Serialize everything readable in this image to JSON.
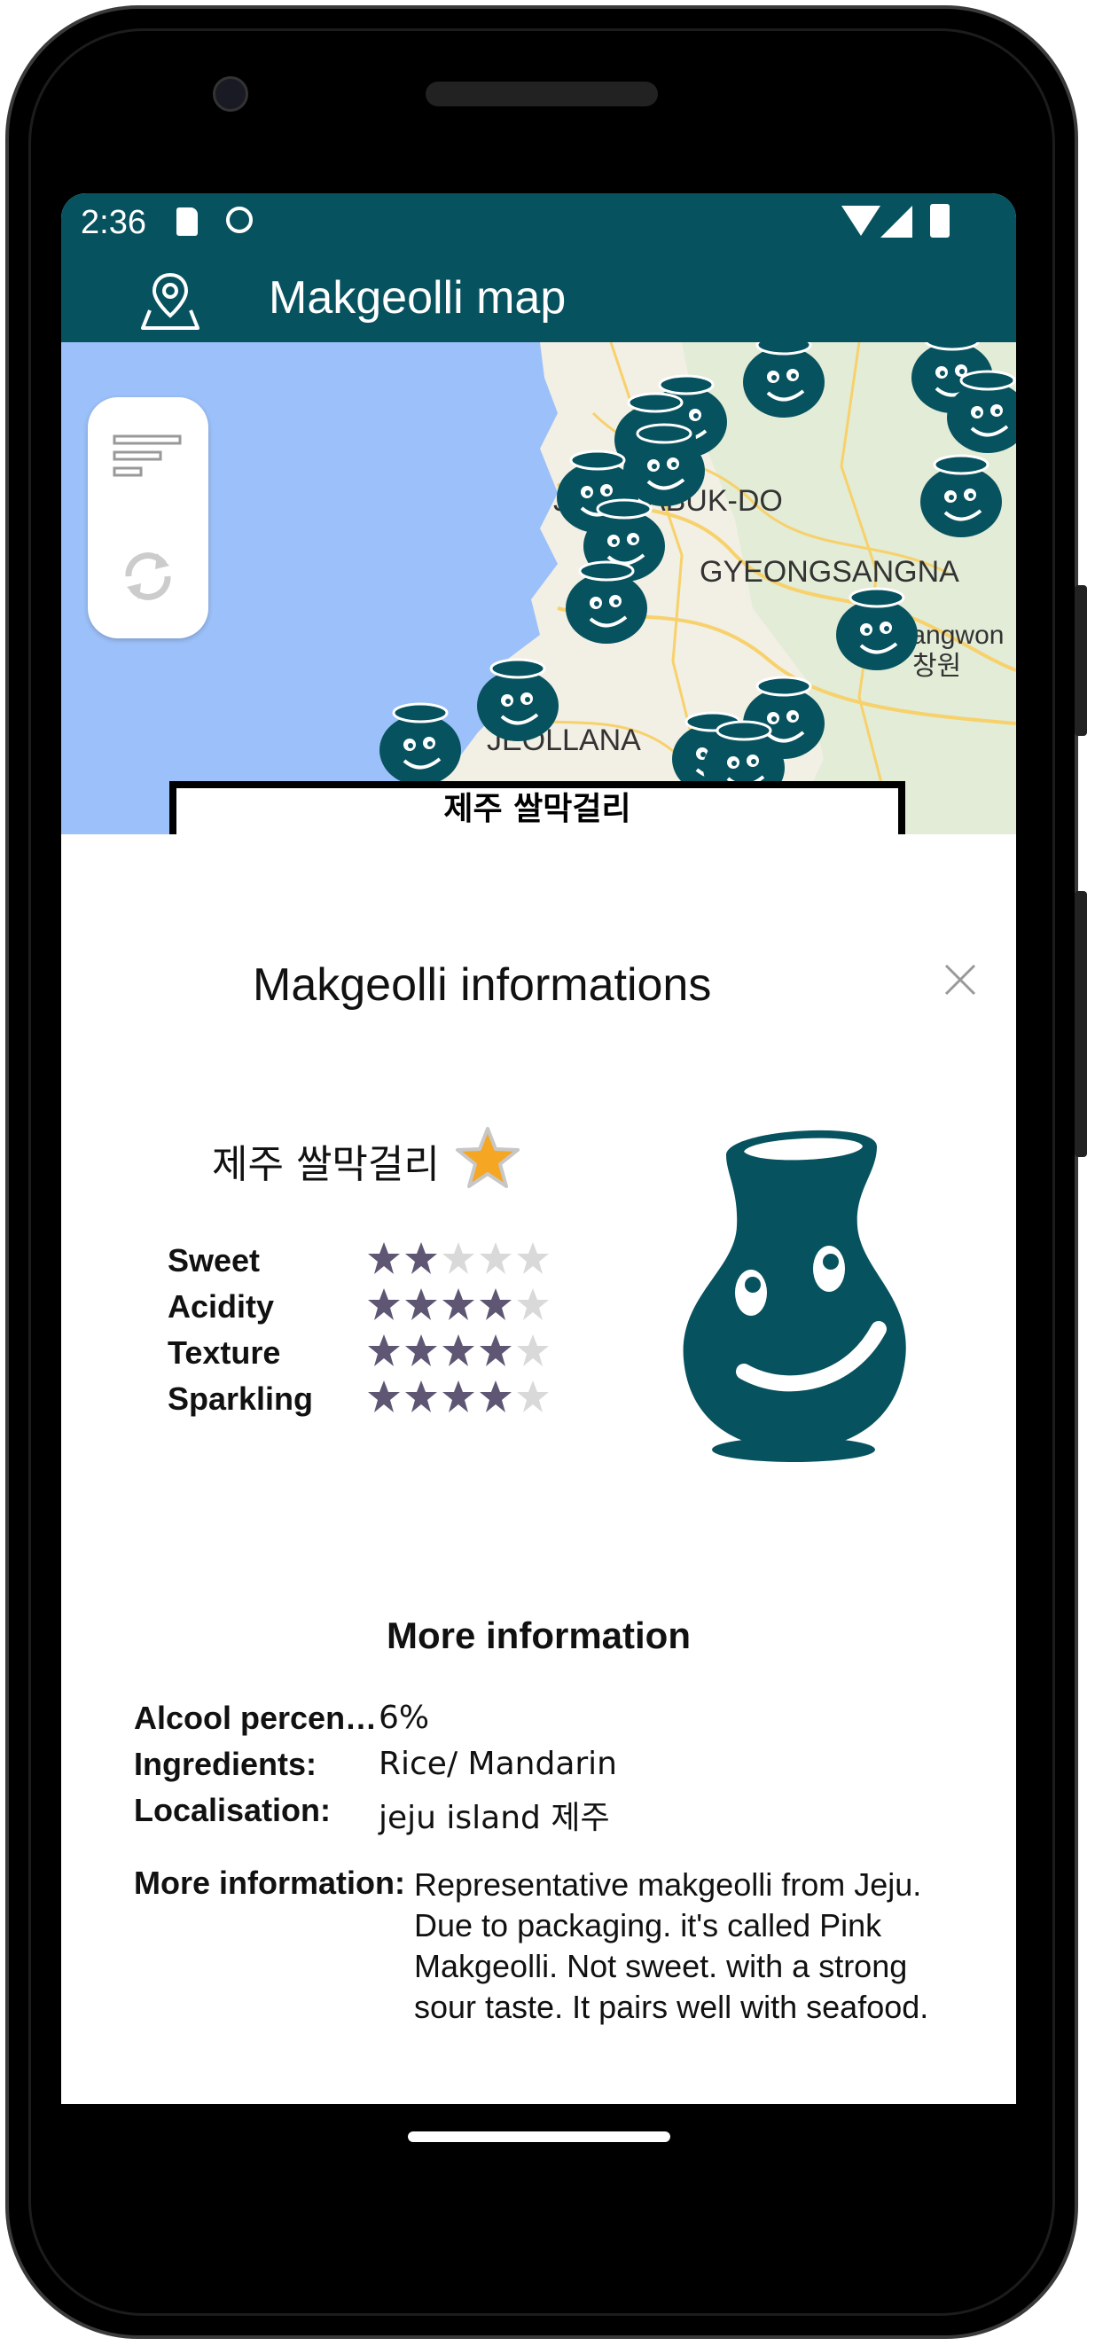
{
  "status_bar": {
    "time": "2:36",
    "icons": [
      "sd-card-icon",
      "face-icon",
      "wifi-icon",
      "cell-signal-icon",
      "battery-icon"
    ]
  },
  "app_bar": {
    "title": "Makgeolli map",
    "icon": "map-pin-icon"
  },
  "map": {
    "labels": [
      "JEOLLABUK-DO",
      "GYEONGSANGNA",
      "JEOLLANA",
      "Changwon",
      "창원"
    ],
    "selected_marker_label": "제주 쌀막걸리",
    "float_buttons": [
      "filter-icon",
      "refresh-icon"
    ]
  },
  "sheet": {
    "title": "Makgeolli informations",
    "close_icon": "close-icon",
    "makgeolli_name": "제주 쌀막걸리",
    "favorite": true,
    "ratings": [
      {
        "label": "Sweet",
        "value": 2,
        "max": 5
      },
      {
        "label": "Acidity",
        "value": 4,
        "max": 5
      },
      {
        "label": "Texture",
        "value": 4,
        "max": 5
      },
      {
        "label": "Sparkling",
        "value": 4,
        "max": 5
      }
    ],
    "more_title": "More information",
    "info": [
      {
        "label": "Alcool percen…",
        "value": "6%"
      },
      {
        "label": "Ingredients:",
        "value": "Rice/ Mandarin"
      },
      {
        "label": "Localisation:",
        "value": "jeju island 제주"
      }
    ],
    "description_label": "More information:",
    "description": "Representative makgeolli from Jeju. Due to packaging. it's called Pink Makgeolli. Not sweet. with a strong sour taste. It pairs well with seafood."
  },
  "colors": {
    "primary": "#07525f",
    "star_filled": "#5e5673",
    "star_empty": "#d9d9d9",
    "favorite_star": "#f5a623",
    "map_water": "#9cc0f9",
    "map_land": "#f2efe4"
  }
}
